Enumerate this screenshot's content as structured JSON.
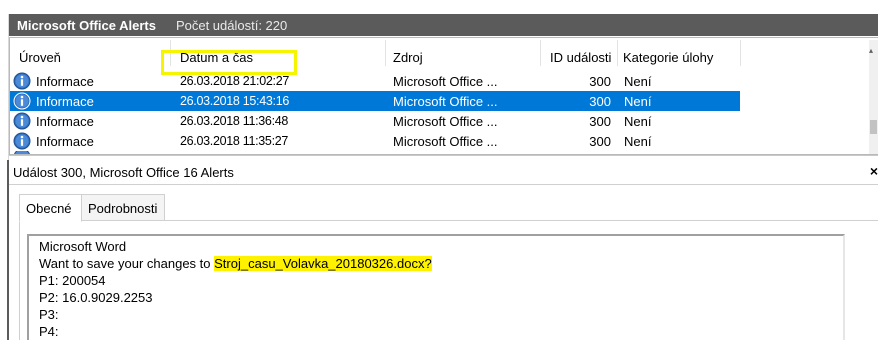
{
  "title_bar": {
    "log_name": "Microsoft Office Alerts",
    "event_count": "Počet událostí: 220"
  },
  "columns": [
    "Úroveň",
    "Datum a čas",
    "Zdroj",
    "ID události",
    "Kategorie úlohy"
  ],
  "rows": [
    {
      "level": "Informace",
      "datetime": "26.03.2018 21:02:27",
      "source": "Microsoft Office ...",
      "event_id": "300",
      "category": "Není",
      "selected": false
    },
    {
      "level": "Informace",
      "datetime": "26.03.2018 15:43:16",
      "source": "Microsoft Office ...",
      "event_id": "300",
      "category": "Není",
      "selected": true
    },
    {
      "level": "Informace",
      "datetime": "26.03.2018 11:36:48",
      "source": "Microsoft Office ...",
      "event_id": "300",
      "category": "Není",
      "selected": false
    },
    {
      "level": "Informace",
      "datetime": "26.03.2018 11:35:27",
      "source": "Microsoft Office ...",
      "event_id": "300",
      "category": "Není",
      "selected": false
    }
  ],
  "detail": {
    "header": "Událost 300, Microsoft Office 16 Alerts",
    "close_icon": "×",
    "tabs": [
      "Obecné",
      "Podrobnosti"
    ],
    "lines": [
      "Microsoft Word",
      "Want to save your changes to ",
      "Stroj_casu_Volavka_20180326.docx?",
      "P1: 200054",
      "P2: 16.0.9029.2253",
      "P3:",
      "P4:"
    ]
  },
  "colors": {
    "title_bg": "#5b5b5b",
    "selection": "#0078d7",
    "highlight": "#fff200",
    "highlight_box": "#f5f500"
  },
  "icons": {
    "level": "info-icon"
  }
}
